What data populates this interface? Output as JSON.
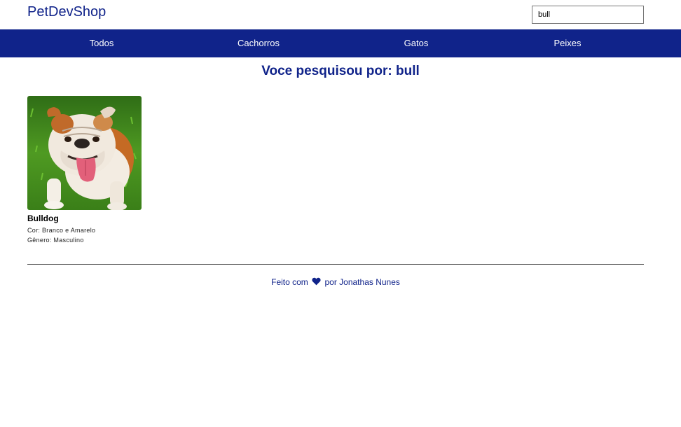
{
  "header": {
    "logo": "PetDevShop",
    "search": {
      "value": "bull",
      "placeholder": ""
    }
  },
  "nav": {
    "items": [
      {
        "label": "Todos"
      },
      {
        "label": "Cachorros"
      },
      {
        "label": "Gatos"
      },
      {
        "label": "Peixes"
      }
    ]
  },
  "results": {
    "heading": "Voce pesquisou por: bull",
    "items": [
      {
        "name": "Bulldog",
        "color": "Cor: Branco e Amarelo",
        "gender": "Gênero: Masculino"
      }
    ]
  },
  "footer": {
    "prefix": "Feito com",
    "suffix": "por Jonathas Nunes"
  },
  "colors": {
    "brand": "#10238a",
    "nav_text": "#ffffff"
  }
}
